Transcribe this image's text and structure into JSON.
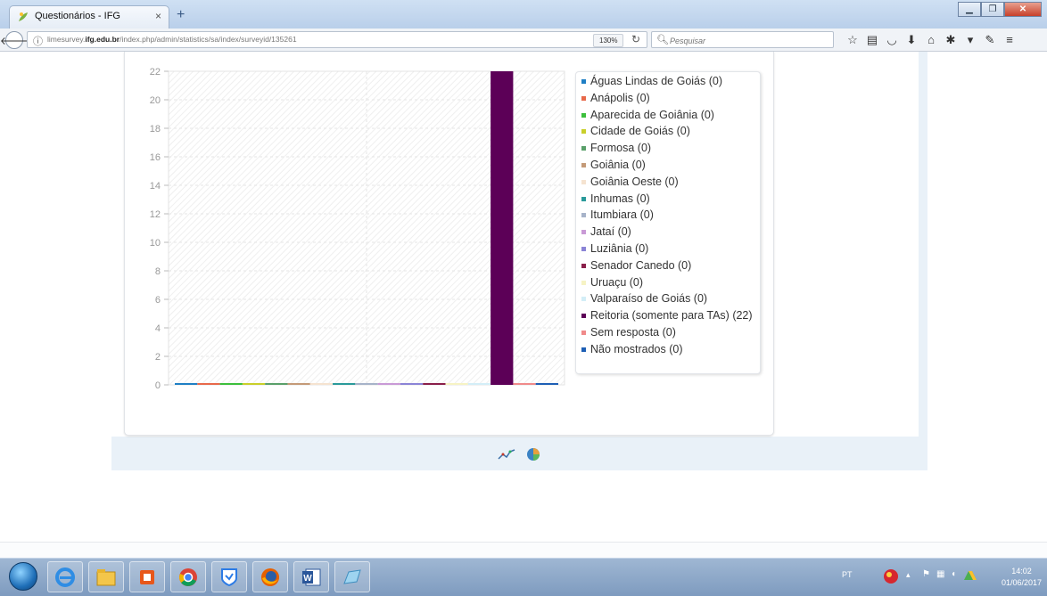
{
  "browser": {
    "tab_title": "Questionários - IFG",
    "tab_close": "×",
    "new_tab": "+",
    "url_prefix": "limesurvey.",
    "url_domain": "ifg.edu.br",
    "url_rest": "/index.php/admin/statistics/sa/index/surveyid/135261",
    "zoom": "130%",
    "search_placeholder": "Pesquisar"
  },
  "chart_data": {
    "type": "bar",
    "ylim": [
      0,
      22
    ],
    "yticks": [
      "22",
      "20",
      "18",
      "16",
      "14",
      "12",
      "10",
      "8",
      "6",
      "4",
      "2",
      "0"
    ],
    "grid": true,
    "legend_position": "right",
    "series": [
      {
        "name": "Águas Lindas de Goiás (0)",
        "value": 0,
        "color": "#1f7fc4"
      },
      {
        "name": "Anápolis (0)",
        "value": 0,
        "color": "#e8694a"
      },
      {
        "name": "Aparecida de Goiânia (0)",
        "value": 0,
        "color": "#3cbf3c"
      },
      {
        "name": "Cidade de Goiás (0)",
        "value": 0,
        "color": "#c9cf2a"
      },
      {
        "name": "Formosa (0)",
        "value": 0,
        "color": "#5aa06a"
      },
      {
        "name": "Goiânia (0)",
        "value": 0,
        "color": "#c49a78"
      },
      {
        "name": "Goiânia Oeste (0)",
        "value": 0,
        "color": "#f5e3d0"
      },
      {
        "name": "Inhumas (0)",
        "value": 0,
        "color": "#2a9a9a"
      },
      {
        "name": "Itumbiara (0)",
        "value": 0,
        "color": "#a7b3c9"
      },
      {
        "name": "Jataí (0)",
        "value": 0,
        "color": "#c99ad6"
      },
      {
        "name": "Luziânia (0)",
        "value": 0,
        "color": "#8b84d6"
      },
      {
        "name": "Senador Canedo (0)",
        "value": 0,
        "color": "#8a1f4a"
      },
      {
        "name": "Uruaçu (0)",
        "value": 0,
        "color": "#f6f3c4"
      },
      {
        "name": "Valparaíso de Goiás (0)",
        "value": 0,
        "color": "#d3eef7"
      },
      {
        "name": "Reitoria (somente para TAs) (22)",
        "value": 22,
        "color": "#5c0057"
      },
      {
        "name": "Sem resposta (0)",
        "value": 0,
        "color": "#f08a8a"
      },
      {
        "name": "Não mostrados (0)",
        "value": 0,
        "color": "#1e5fb5"
      }
    ]
  },
  "taskbar": {
    "language": "PT",
    "time": "14:02",
    "date": "01/06/2017"
  }
}
